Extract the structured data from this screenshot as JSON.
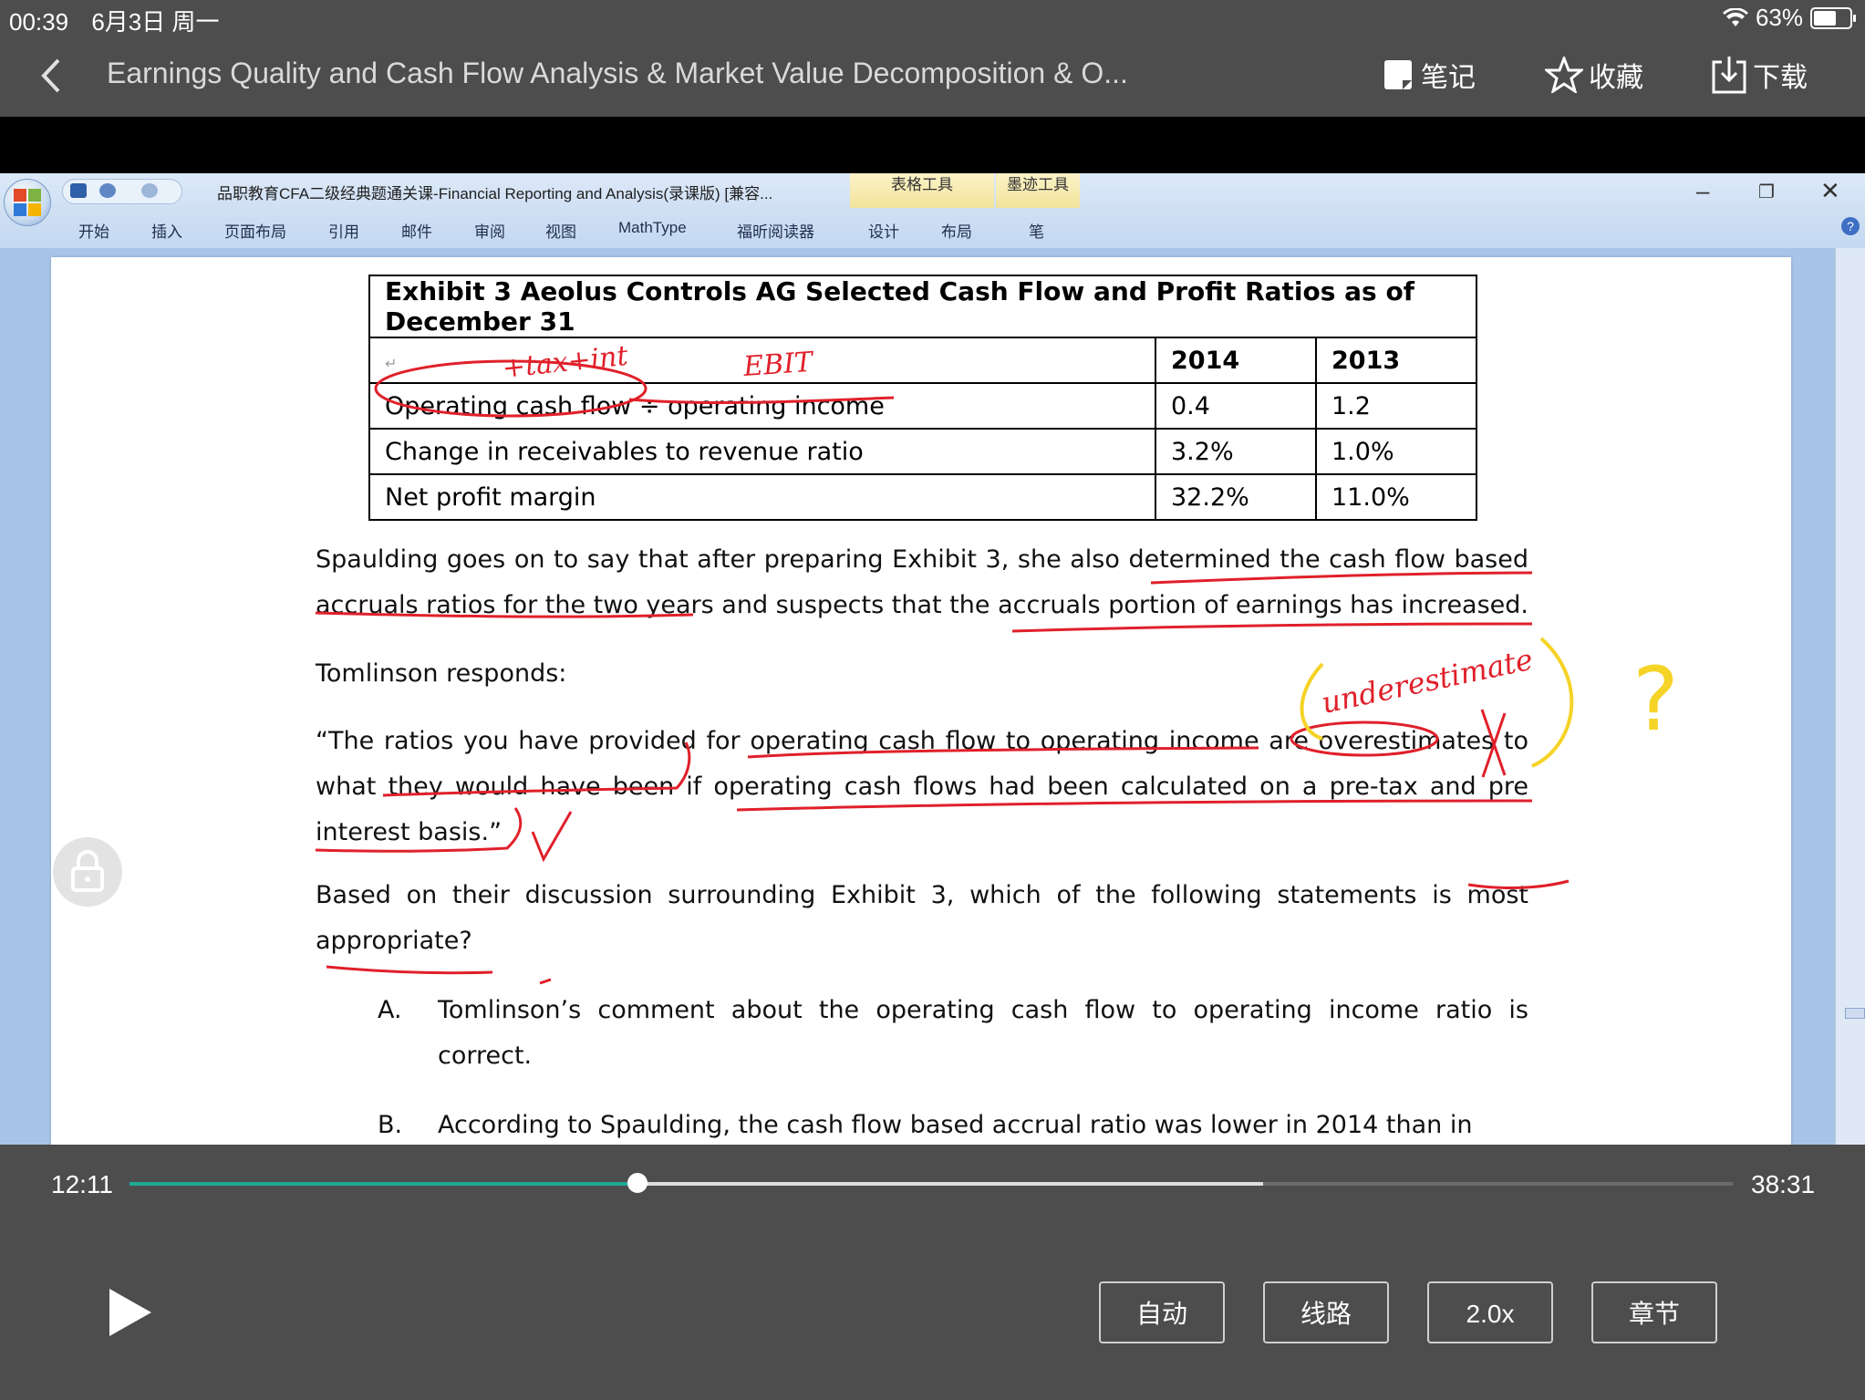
{
  "status_bar": {
    "time": "00:39",
    "date": "6月3日 周一",
    "battery": "63%",
    "battery_level": 0.63
  },
  "nav": {
    "title": "Earnings Quality and Cash Flow Analysis & Market Value Decomposition & O...",
    "notes_label": "笔记",
    "favorite_label": "收藏",
    "download_label": "下载"
  },
  "word": {
    "doc_title": "品职教育CFA二级经典题通关课-Financial Reporting and Analysis(录课版) [兼容...",
    "context_tab_table": "表格工具",
    "context_tab_ink": "墨迹工具",
    "tabs": [
      "开始",
      "插入",
      "页面布局",
      "引用",
      "邮件",
      "审阅",
      "视图",
      "MathType",
      "福昕阅读器",
      "设计",
      "布局",
      "笔"
    ]
  },
  "exhibit": {
    "title": "Exhibit 3 Aeolus Controls AG Selected Cash Flow and Profit Ratios as of December 31",
    "col_2014": "2014",
    "col_2013": "2013",
    "rows": [
      {
        "label": "Operating cash flow ÷ operating income",
        "v2014": "0.4",
        "v2013": "1.2"
      },
      {
        "label": "Change in receivables to revenue ratio",
        "v2014": "3.2%",
        "v2013": "1.0%"
      },
      {
        "label": "Net profit margin",
        "v2014": "32.2%",
        "v2013": "11.0%"
      }
    ]
  },
  "body": {
    "p1": "Spaulding goes on to say that after preparing Exhibit 3, she also determined the cash flow based accruals ratios for the two years and suspects that the accruals portion of earnings has increased.",
    "p2": "Tomlinson responds:",
    "p3": "“The ratios you have provided for operating cash flow to operating income are overestimates to what they would have been if operating cash flows had been calculated on a pre-tax and pre interest basis.”",
    "p4": "Based on their discussion surrounding Exhibit 3, which of the following statements is most appropriate?",
    "optA_label": "A.",
    "optA": "Tomlinson’s comment about the operating cash flow to operating income ratio is correct.",
    "optB_label": "B.",
    "optB": "According to Spaulding, the cash flow based accrual ratio was lower in 2014 than in"
  },
  "annotations": {
    "a1": "+tax+int",
    "a2": "EBIT",
    "a3": "underestimate",
    "a4": "?"
  },
  "player": {
    "current_time": "12:11",
    "total_time": "38:31",
    "progress": 0.317,
    "buffered": 0.707,
    "auto_label": "自动",
    "route_label": "线路",
    "speed_label": "2.0x",
    "chapter_label": "章节"
  },
  "colors": {
    "progress": "#1faa96",
    "ink_red": "#e0202a",
    "ink_yellow": "#f5d327"
  }
}
